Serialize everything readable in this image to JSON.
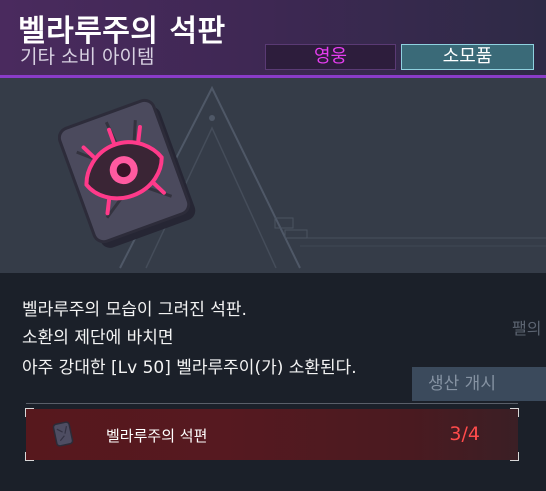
{
  "item": {
    "name": "벨라루주의 석판",
    "category": "기타 소비 아이템",
    "icon": "eye-rune-tablet-icon"
  },
  "tags": [
    {
      "label": "영웅",
      "color": "#e63df0"
    },
    {
      "label": "소모품",
      "color": "#ffffff"
    }
  ],
  "description": [
    "벨라루주의 모습이 그려진 석판.",
    "소환의 제단에 바치면",
    "아주 강대한 [Lv 50] 벨라루주이(가) 소환된다."
  ],
  "background": {
    "ghost_text": "팰의",
    "ghost_button": "생산 개시"
  },
  "material": {
    "name": "벨라루주의 석편",
    "count": "3/4",
    "icon": "stone-fragment-icon",
    "count_color": "#ff4b4b"
  }
}
